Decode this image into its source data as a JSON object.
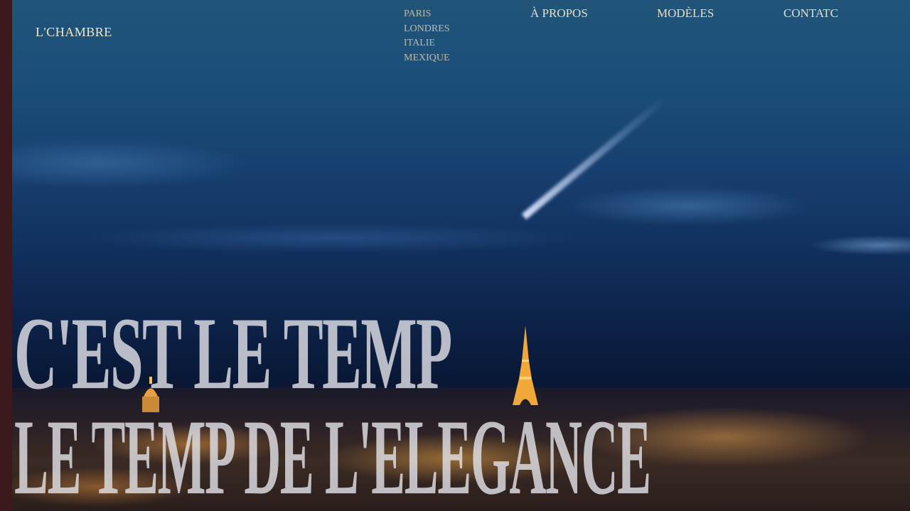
{
  "brand": "L'CHAMBRE",
  "cities_menu": [
    "PARIS",
    "LONDRES",
    "ITALIE",
    "MEXIQUE"
  ],
  "nav": {
    "about": "À PROPOS",
    "models": "MODÈLES",
    "contact": "CONTATC"
  },
  "hero": {
    "line1": "C'EST LE TEMP",
    "line2": "LE TEMP DE L'ELEGANCE"
  },
  "colors": {
    "sidebar": "#3a1a1c",
    "nav_text": "#e9ddc4",
    "headline": "#e1e1e6"
  },
  "icons": [
    "eiffel-tower-illustration",
    "dome-illustration"
  ]
}
